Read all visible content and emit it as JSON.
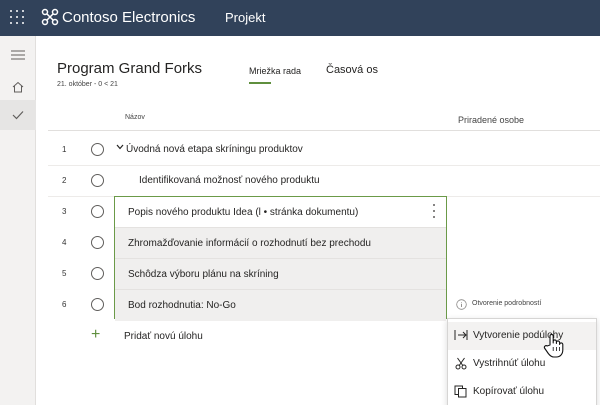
{
  "topbar": {
    "brand": "Contoso Electronics",
    "app": "Projekt",
    "bg_color": "#31425a"
  },
  "rail": {
    "items": [
      {
        "icon": "hamburger-icon"
      },
      {
        "icon": "home-icon"
      },
      {
        "icon": "checkmark-icon"
      }
    ]
  },
  "plan": {
    "title": "Program Grand Forks",
    "subtitle": "21. október - 0 < 21"
  },
  "tabs": [
    {
      "label": "Mriežka rada",
      "active": true
    },
    {
      "label": "Časová os",
      "active": false
    }
  ],
  "columns": {
    "name": "Názov",
    "assigned": "Priradené osobe"
  },
  "rows": [
    {
      "num": "1",
      "text": "Úvodná nová etapa skríningu produktov"
    },
    {
      "num": "2",
      "text": "Identifikovaná možnosť nového produktu"
    },
    {
      "num": "3",
      "text": "Popis nového produktu Idea (l • stránka dokumentu)"
    },
    {
      "num": "4",
      "text": "Zhromažďovanie informácií o rozhodnutí bez prechodu"
    },
    {
      "num": "5",
      "text": "Schôdza výboru plánu na skríning"
    },
    {
      "num": "6",
      "text": "Bod rozhodnutia: No-Go"
    }
  ],
  "add_task": "Pridať novú úlohu",
  "open_details": "Otvorenie podrobností",
  "menu": [
    {
      "label": "Vytvorenie podúlohy",
      "icon": "indent-icon"
    },
    {
      "label": "Vystrihnúť úlohu",
      "icon": "scissors-icon"
    },
    {
      "label": "Kopírovať úlohu",
      "icon": "copy-icon"
    }
  ],
  "accent_color": "#5f8f3e"
}
